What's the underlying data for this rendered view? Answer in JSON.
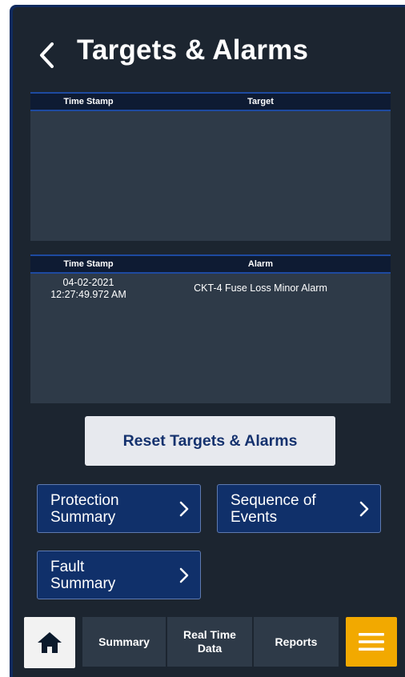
{
  "header": {
    "title": "Targets & Alarms",
    "back_icon": "chevron-left-icon"
  },
  "targets_table": {
    "columns": [
      "Time Stamp",
      "Target"
    ],
    "rows": []
  },
  "alarms_table": {
    "columns": [
      "Time Stamp",
      "Alarm"
    ],
    "rows": [
      {
        "date": "04-02-2021",
        "time": "12:27:49.972 AM",
        "alarm": "CKT-4 Fuse Loss Minor Alarm"
      }
    ]
  },
  "reset_button": {
    "label": "Reset Targets & Alarms"
  },
  "nav_buttons": {
    "protection_summary": {
      "line1": "Protection",
      "line2": "Summary",
      "icon": "chevron-right-icon"
    },
    "sequence_of_events": {
      "line1": "Sequence of",
      "line2": "Events",
      "icon": "chevron-right-icon"
    },
    "fault_summary": {
      "line1": "Fault",
      "line2": "Summary",
      "icon": "chevron-right-icon"
    }
  },
  "bottom_nav": {
    "home_icon": "home-icon",
    "tabs": [
      {
        "line1": "Summary",
        "line2": ""
      },
      {
        "line1": "Real Time",
        "line2": "Data"
      },
      {
        "line1": "Reports",
        "line2": ""
      }
    ],
    "menu_icon": "hamburger-menu-icon"
  },
  "colors": {
    "background": "#1c2530",
    "panel": "#2e3a48",
    "nav_button": "#10306a",
    "accent_menu": "#f2a900",
    "reset_text": "#15326e"
  }
}
